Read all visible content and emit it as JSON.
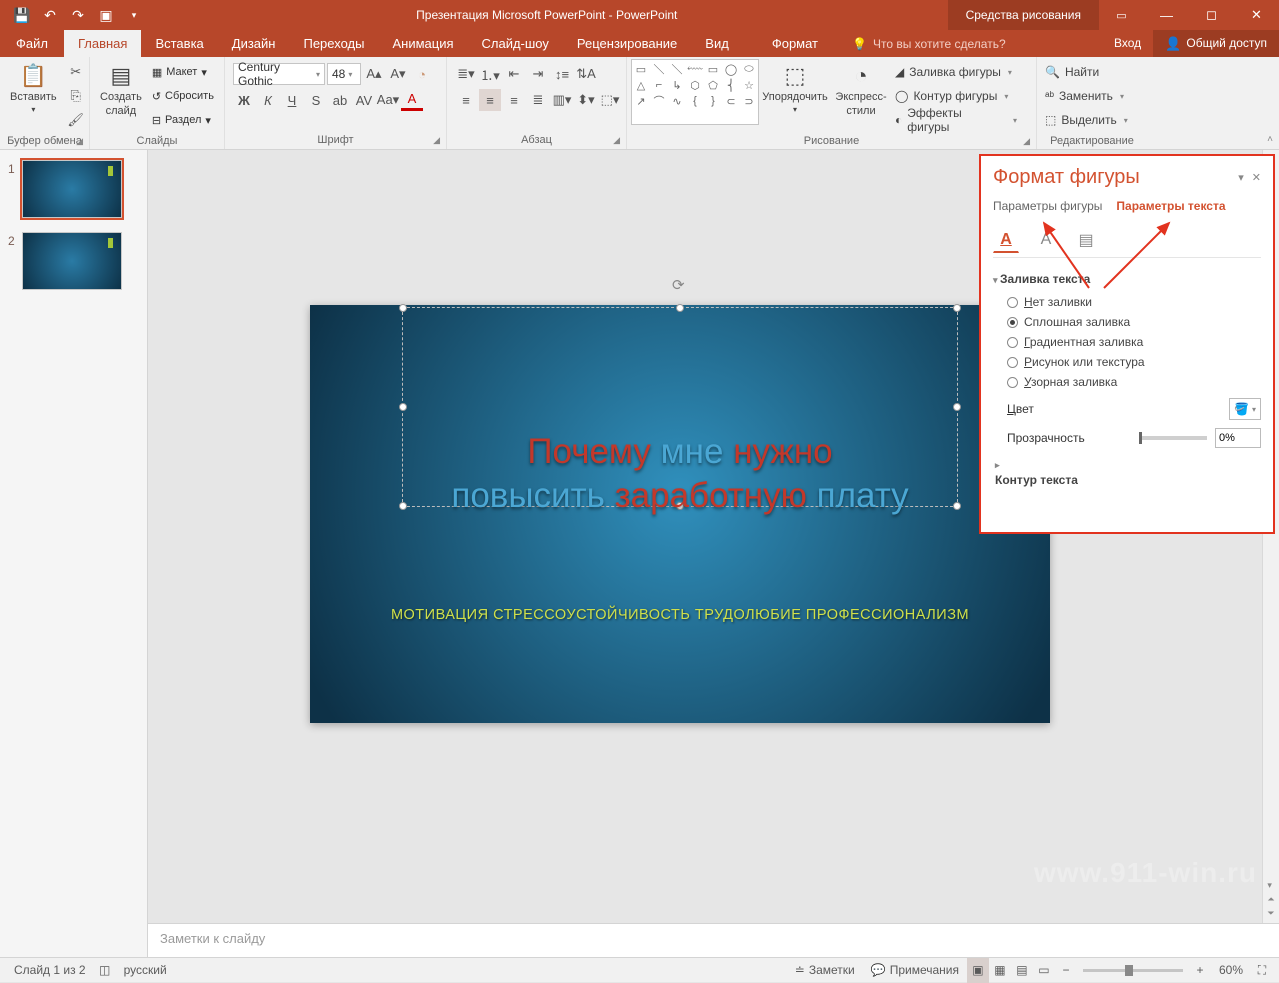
{
  "titlebar": {
    "title": "Презентация Microsoft PowerPoint - PowerPoint",
    "context_tab": "Средства рисования"
  },
  "tabs": {
    "file": "Файл",
    "home": "Главная",
    "insert": "Вставка",
    "design": "Дизайн",
    "transitions": "Переходы",
    "animations": "Анимация",
    "slideshow": "Слайд-шоу",
    "review": "Рецензирование",
    "view": "Вид",
    "format": "Формат",
    "tellme": "Что вы хотите сделать?",
    "signin": "Вход",
    "share": "Общий доступ"
  },
  "ribbon": {
    "clipboard": {
      "paste": "Вставить",
      "label": "Буфер обмена"
    },
    "slides": {
      "new": "Создать\nслайд",
      "layout": "Макет",
      "reset": "Сбросить",
      "section": "Раздел",
      "label": "Слайды"
    },
    "font": {
      "name": "Century Gothic",
      "size": "48",
      "label": "Шрифт"
    },
    "paragraph": {
      "label": "Абзац"
    },
    "drawing": {
      "arrange": "Упорядочить",
      "quick": "Экспресс-\nстили",
      "fill": "Заливка фигуры",
      "outline": "Контур фигуры",
      "effects": "Эффекты фигуры",
      "label": "Рисование"
    },
    "editing": {
      "find": "Найти",
      "replace": "Заменить",
      "select": "Выделить",
      "label": "Редактирование"
    }
  },
  "thumbs": {
    "n1": "1",
    "n2": "2"
  },
  "slide": {
    "title_p1_r": "Почему ",
    "title_p1_b": "мне ",
    "title_p1_r2": "нужно",
    "title_p2_b": "повысить ",
    "title_p2_r": "заработную ",
    "title_p2_b2": "плату",
    "subtitle": "МОТИВАЦИЯ СТРЕССОУСТОЙЧИВОСТЬ ТРУДОЛЮБИЕ ПРОФЕССИОНАЛИЗМ"
  },
  "notes": {
    "placeholder": "Заметки к слайду"
  },
  "pane": {
    "title": "Формат фигуры",
    "tab_shape": "Параметры фигуры",
    "tab_text": "Параметры текста",
    "sec_fill": "Заливка текста",
    "r_none": "Нет заливки",
    "r_solid": "Сплошная заливка",
    "r_grad": "Градиентная заливка",
    "r_pic": "Рисунок или текстура",
    "r_pat": "Узорная заливка",
    "color": "Цвет",
    "transp": "Прозрачность",
    "transp_val": "0%",
    "sec_outline": "Контур текста"
  },
  "statusbar": {
    "slide": "Слайд 1 из 2",
    "lang": "русский",
    "notes": "Заметки",
    "comments": "Примечания",
    "zoom": "60%"
  },
  "watermark": "www.911-win.ru"
}
